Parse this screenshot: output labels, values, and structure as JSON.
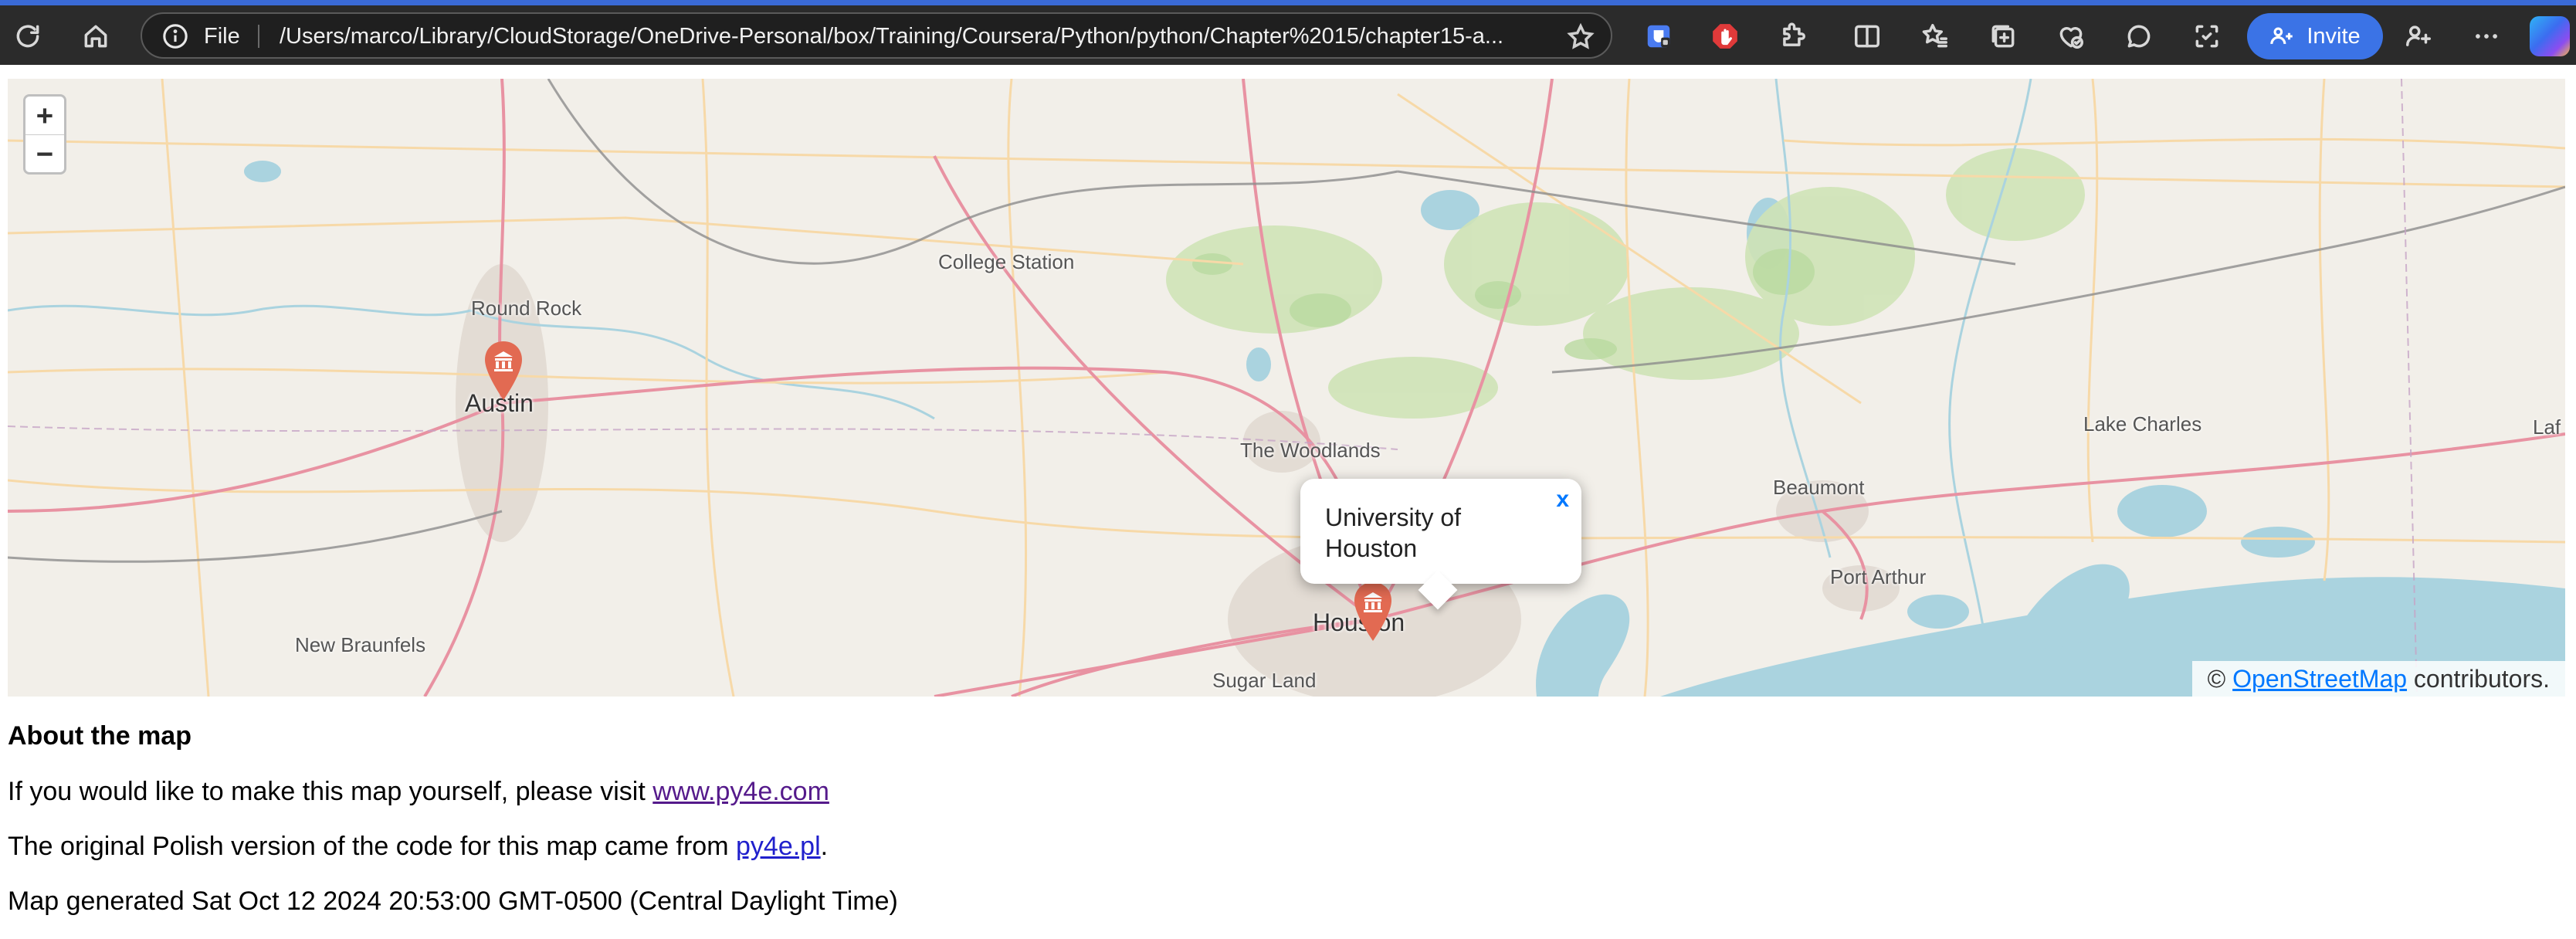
{
  "browser": {
    "scheme_label": "File",
    "url": "/Users/marco/Library/CloudStorage/OneDrive-Personal/box/Training/Coursera/Python/python/Chapter%2015/chapter15-a...",
    "invite_label": "Invite",
    "accent_color": "#3b73e6"
  },
  "map": {
    "zoom_in": "+",
    "zoom_out": "−",
    "places": {
      "college_station": "College Station",
      "round_rock": "Round Rock",
      "austin": "Austin",
      "the_woodlands": "The Woodlands",
      "beaumont": "Beaumont",
      "lake_charles": "Lake Charles",
      "port_arthur": "Port Arthur",
      "houston": "Houston",
      "sugar_land": "Sugar Land",
      "new_braunfels": "New Braunfels",
      "laf": "Laf"
    },
    "popup": {
      "text": "University of Houston",
      "close": "x"
    },
    "attribution": {
      "prefix": "©",
      "link": "OpenStreetMap",
      "suffix": "contributors."
    },
    "marker_color": "#e26a52"
  },
  "about": {
    "heading": "About the map",
    "line1_text": "If you would like to make this map yourself, please visit",
    "line1_link": "www.py4e.com",
    "line2_text": "The original Polish version of the code for this map came from",
    "line2_link": "py4e.pl",
    "line2_end": ".",
    "generated": "Map generated Sat Oct 12 2024 20:53:00 GMT-0500 (Central Daylight Time)"
  }
}
